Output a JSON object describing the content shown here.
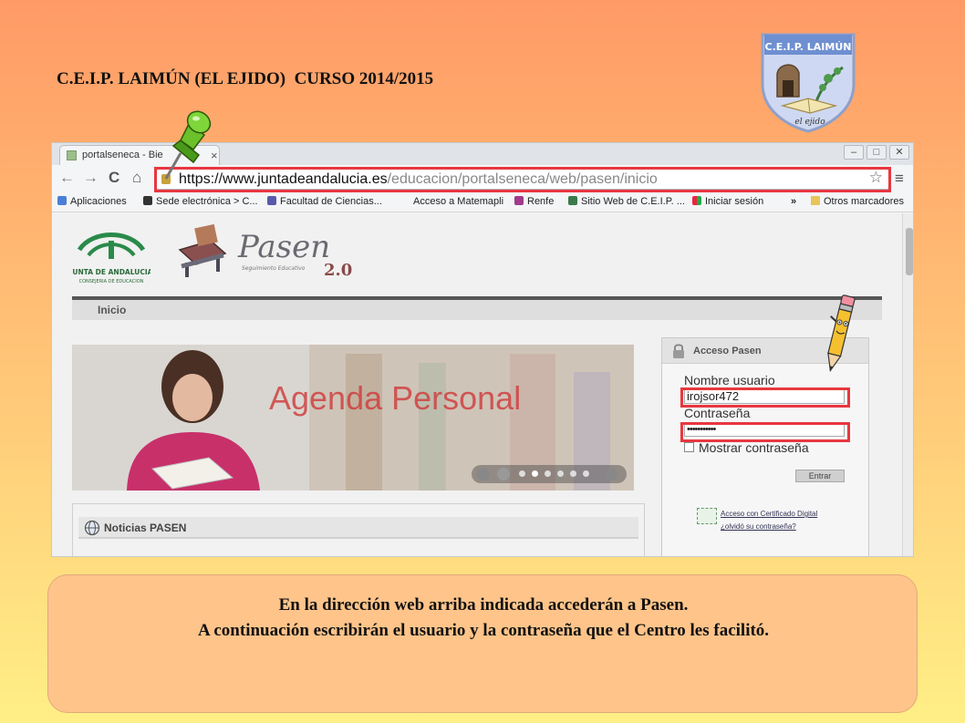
{
  "slide": {
    "title": "C.E.I.P. LAIMÚN (EL EJIDO)  CURSO 2014/2015",
    "logo_text": "C.E.I.P. LAIMÚN"
  },
  "browser": {
    "tab_title": "portalseneca - Bie",
    "tab_close": "×",
    "window_controls": [
      "–",
      "□",
      "✕"
    ],
    "nav": {
      "back": "←",
      "forward": "→",
      "reload": "C",
      "home": "⌂"
    },
    "url_host": "https://www.juntadeandalucia.es",
    "url_path": "/educacion/portalseneca/web/pasen/inicio",
    "star": "☆",
    "menu": "≡",
    "bookmarks": [
      "Aplicaciones",
      "Sede electrónica > C...",
      "Facultad de Ciencias...",
      "Acceso a Matemapli",
      "Renfe",
      "Sitio Web de C.E.I.P. ...",
      "Iniciar sesión",
      "»",
      "Otros marcadores"
    ],
    "colors": {
      "highlight": "#e8373f"
    }
  },
  "website": {
    "junta_line1": "JUNTA DE ANDALUCIA",
    "junta_line2": "CONSEJERIA DE EDUCACION",
    "pasen_word": "Pasen",
    "pasen_sub": "Seguimiento Educativo",
    "pasen_version": "2.0",
    "breadcrumb": "Inicio",
    "banner_text": "Agenda Personal",
    "news_title": "Noticias PASEN",
    "login": {
      "title": "Acceso Pasen",
      "user_label": "Nombre usuario",
      "user_value": "irojsor472",
      "password_label": "Contraseña",
      "password_value": "•••••••••••",
      "show_password": "Mostrar contraseña",
      "submit": "Entrar",
      "cert_link": "Acceso con Certificado Digital",
      "forgot_link": "¿olvidó su contraseña?"
    }
  },
  "caption": {
    "line1": "En la dirección web arriba indicada accederán a Pasen.",
    "line2": "A continuación escribirán el usuario y la contraseña que el Centro les facilitó."
  }
}
